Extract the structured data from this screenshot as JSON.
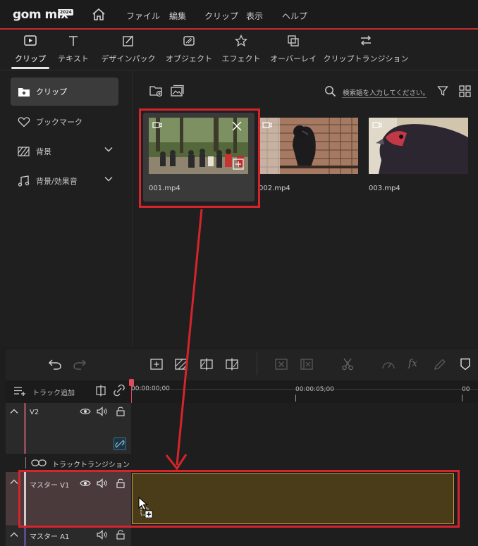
{
  "app": {
    "logo": "gom mix",
    "logo_badge": "2024"
  },
  "menu": [
    "ファイル",
    "編集",
    "クリップ",
    "表示",
    "ヘルプ"
  ],
  "tabs": [
    "クリップ",
    "テキスト",
    "デザインパック",
    "オブジェクト",
    "エフェクト",
    "オーバーレイ",
    "クリップトランジション"
  ],
  "sidebar": {
    "items": [
      {
        "label": "クリップ",
        "icon": "folder-plus-icon"
      },
      {
        "label": "ブックマーク",
        "icon": "heart-icon"
      },
      {
        "label": "背景",
        "icon": "hatch-icon"
      },
      {
        "label": "背景/効果音",
        "icon": "music-note-icon"
      }
    ]
  },
  "media": {
    "search_placeholder": "検索語を入力してください。",
    "clips": [
      {
        "name": "001.mp4"
      },
      {
        "name": "002.mp4"
      },
      {
        "name": "003.mp4"
      }
    ]
  },
  "timeline": {
    "add_track": "トラック追加",
    "timecodes": [
      "00:00:00;00",
      "00:00:05;00",
      "00"
    ],
    "tracks": {
      "v2": "V2",
      "transition": "トラックトランジション",
      "master_v1": "マスター V1",
      "master_a1": "マスター A1"
    }
  },
  "colors": {
    "accent": "#d6242c",
    "clip_fill": "#4a3c19",
    "clip_border": "#c9a14a",
    "playhead": "#e14a5a"
  }
}
